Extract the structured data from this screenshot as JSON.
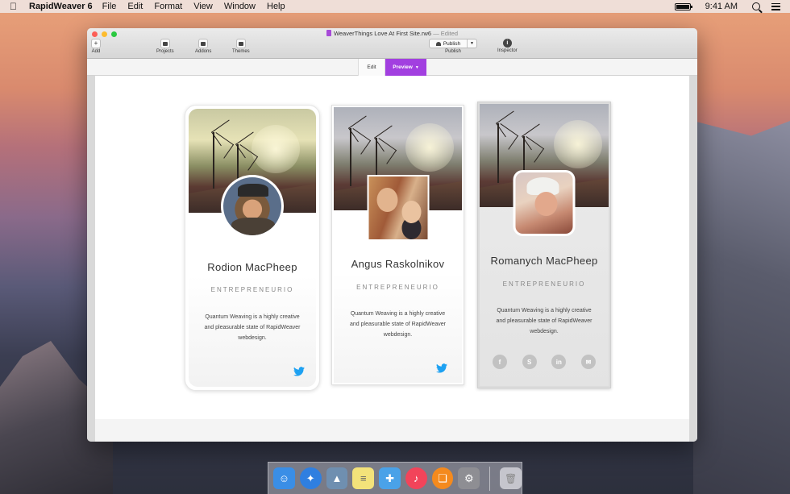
{
  "menubar": {
    "app_name": "RapidWeaver 6",
    "menus": [
      "File",
      "Edit",
      "Format",
      "View",
      "Window",
      "Help"
    ],
    "clock": "9:41 AM"
  },
  "window": {
    "title": "WeaverThings Love At First Site.rw6",
    "title_status": "— Edited",
    "toolbar": {
      "add": "Add",
      "projects": "Projects",
      "addons": "Addons",
      "themes": "Themes",
      "publish_button": "Publish",
      "publish_label": "Publish",
      "inspector": "Inspector"
    },
    "modes": {
      "edit": "Edit",
      "preview": "Preview"
    }
  },
  "cards": [
    {
      "name": "Rodion MacPheep",
      "role": "ENTREPRENEURIO",
      "bio_line1": "Quantum Weaving is a highly creative",
      "bio_line2": "and pleasurable state of RapidWeaver",
      "bio_line3": "webdesign."
    },
    {
      "name": "Angus Raskolnikov",
      "role": "ENTREPRENEURIO",
      "bio_line1": "Quantum Weaving is a highly creative",
      "bio_line2": "and pleasurable state of RapidWeaver",
      "bio_line3": "webdesign."
    },
    {
      "name": "Romanych MacPheep",
      "role": "ENTREPRENEURIO",
      "bio_line1": "Quantum Weaving is a highly creative",
      "bio_line2": "and pleasurable state of RapidWeaver",
      "bio_line3": "webdesign.",
      "socials": [
        {
          "icon": "facebook-icon",
          "glyph": "f"
        },
        {
          "icon": "skype-icon",
          "glyph": "S"
        },
        {
          "icon": "linkedin-icon",
          "glyph": "in"
        },
        {
          "icon": "email-icon",
          "glyph": "✉"
        }
      ]
    }
  ],
  "colors": {
    "accent_preview": "#a23fe0",
    "twitter": "#1da1f2",
    "social_gray": "#c2c2c2"
  },
  "dock": {
    "apps": [
      {
        "name": "finder-icon",
        "color": "#3a8ee6",
        "glyph": "☺"
      },
      {
        "name": "safari-icon",
        "color": "#2f7fe0",
        "glyph": "✦"
      },
      {
        "name": "preview-icon",
        "color": "#6f8fb0",
        "glyph": "▲"
      },
      {
        "name": "notes-icon",
        "color": "#f3e27a",
        "glyph": "≡"
      },
      {
        "name": "xcode-icon",
        "color": "#4aa2e8",
        "glyph": "✚"
      },
      {
        "name": "itunes-icon",
        "color": "#f2445a",
        "glyph": "♪"
      },
      {
        "name": "ibooks-icon",
        "color": "#f48a1e",
        "glyph": "❏"
      },
      {
        "name": "system-preferences-icon",
        "color": "#8e8e93",
        "glyph": "⚙"
      }
    ],
    "trash": {
      "name": "trash-icon",
      "color": "#d7d7dc",
      "glyph": "🗑"
    }
  }
}
